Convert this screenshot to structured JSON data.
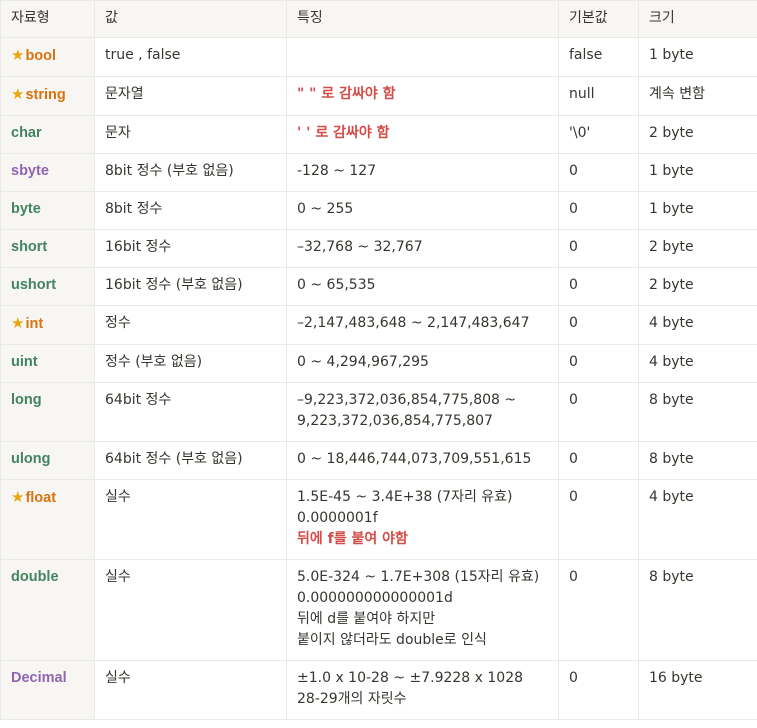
{
  "colors": {
    "orange": "#d9730d",
    "green": "#448361",
    "purple": "#9065b0",
    "red": "#d44c47",
    "star": "#e8a70c",
    "header_bg": "#f7f6f3",
    "border": "#e9e9e7"
  },
  "headers": [
    "자료형",
    "값",
    "특징",
    "기본값",
    "크기"
  ],
  "rows": [
    {
      "type": "bool",
      "star": true,
      "color": "orange",
      "value": "true , false",
      "features": [],
      "default": "false",
      "size": "1 byte"
    },
    {
      "type": "string",
      "star": true,
      "color": "orange",
      "value": "문자열",
      "features": [
        {
          "text": "\" \" 로 감싸야 함",
          "red": true
        }
      ],
      "default": "null",
      "size": "계속 변함"
    },
    {
      "type": "char",
      "star": false,
      "color": "green",
      "value": "문자",
      "features": [
        {
          "text": "' ' 로 감싸야 함",
          "red": true
        }
      ],
      "default": "'\\0'",
      "size": "2 byte"
    },
    {
      "type": "sbyte",
      "star": false,
      "color": "purple",
      "value": "8bit 정수  (부호 없음)",
      "features": [
        {
          "text": "-128 ~ 127"
        }
      ],
      "default": "0",
      "size": "1 byte"
    },
    {
      "type": "byte",
      "star": false,
      "color": "green",
      "value": "8bit 정수",
      "features": [
        {
          "text": "0 ~ 255"
        }
      ],
      "default": "0",
      "size": "1 byte"
    },
    {
      "type": "short",
      "star": false,
      "color": "green",
      "value": "16bit 정수",
      "features": [
        {
          "text": "–32,768 ~ 32,767"
        }
      ],
      "default": "0",
      "size": "2 byte"
    },
    {
      "type": "ushort",
      "star": false,
      "color": "green",
      "value": "16bit 정수  (부호 없음)",
      "features": [
        {
          "text": "0 ~ 65,535"
        }
      ],
      "default": "0",
      "size": "2 byte"
    },
    {
      "type": "int",
      "star": true,
      "color": "orange",
      "value": "정수",
      "features": [
        {
          "text": "–2,147,483,648 ~ 2,147,483,647"
        }
      ],
      "default": "0",
      "size": "4 byte"
    },
    {
      "type": "uint",
      "star": false,
      "color": "green",
      "value": "정수 (부호 없음)",
      "features": [
        {
          "text": "0 ~ 4,294,967,295"
        }
      ],
      "default": "0",
      "size": "4 byte"
    },
    {
      "type": "long",
      "star": false,
      "color": "green",
      "value": "64bit 정수",
      "features": [
        {
          "text": "–9,223,372,036,854,775,808 ~"
        },
        {
          "text": "9,223,372,036,854,775,807"
        }
      ],
      "default": "0",
      "size": "8 byte"
    },
    {
      "type": "ulong",
      "star": false,
      "color": "green",
      "value": "64bit 정수 (부호 없음)",
      "features": [
        {
          "text": "0 ~ 18,446,744,073,709,551,615"
        }
      ],
      "default": "0",
      "size": "8 byte"
    },
    {
      "type": "float",
      "star": true,
      "color": "orange",
      "value": "실수",
      "features": [
        {
          "text": "1.5E-45 ~ 3.4E+38 (7자리 유효)"
        },
        {
          "text": "0.0000001f"
        },
        {
          "text": "뒤에 f를 붙여 야함",
          "red": true
        }
      ],
      "default": "0",
      "size": "4 byte"
    },
    {
      "type": "double",
      "star": false,
      "color": "green",
      "value": "실수",
      "features": [
        {
          "text": "5.0E-324 ~ 1.7E+308 (15자리 유효)"
        },
        {
          "text": "0.000000000000001d"
        },
        {
          "text": "뒤에 d를 붙여야 하지만"
        },
        {
          "text": "붙이지 않더라도 double로 인식"
        }
      ],
      "default": "0",
      "size": "8 byte"
    },
    {
      "type": "Decimal",
      "star": false,
      "color": "purple",
      "value": "실수",
      "features": [
        {
          "text": "±1.0 x 10-28 ~ ±7.9228 x 1028"
        },
        {
          "text": "28-29개의 자릿수"
        }
      ],
      "default": "0",
      "size": "16 byte"
    }
  ]
}
